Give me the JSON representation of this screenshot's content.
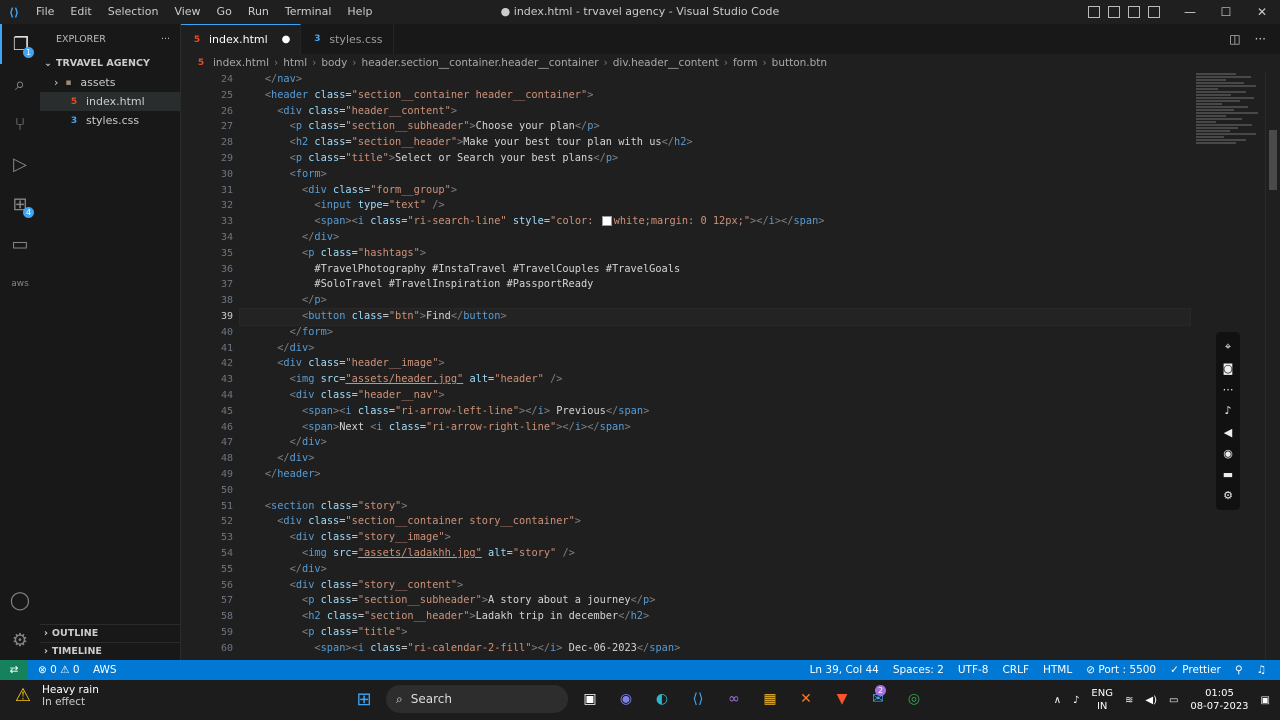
{
  "titlebar": {
    "menu": [
      "File",
      "Edit",
      "Selection",
      "View",
      "Go",
      "Run",
      "Terminal",
      "Help"
    ],
    "title": "● index.html - trvavel agency - Visual Studio Code"
  },
  "sidebar": {
    "header": "EXPLORER",
    "folder": "TRVAVEL AGENCY",
    "items": [
      {
        "label": "assets",
        "type": "folder"
      },
      {
        "label": "index.html",
        "type": "html"
      },
      {
        "label": "styles.css",
        "type": "css"
      }
    ],
    "outline": "OUTLINE",
    "timeline": "TIMELINE"
  },
  "activity": {
    "explorer_badge": "1",
    "extensions_badge": "4"
  },
  "tabs": [
    {
      "label": "index.html",
      "modified": "●",
      "active": true
    },
    {
      "label": "styles.css",
      "modified": "",
      "active": false
    }
  ],
  "breadcrumbs": [
    "index.html",
    "html",
    "body",
    "header.section__container.header__container",
    "div.header__content",
    "form",
    "button.btn"
  ],
  "editor": {
    "line_numbers": [
      "24",
      "25",
      "26",
      "27",
      "28",
      "29",
      "30",
      "31",
      "32",
      "33",
      "34",
      "35",
      "36",
      "37",
      "38",
      "39",
      "40",
      "41",
      "42",
      "43",
      "44",
      "45",
      "46",
      "47",
      "48",
      "49",
      "50",
      "51",
      "52",
      "53",
      "54",
      "55",
      "56",
      "57",
      "58",
      "59",
      "60"
    ],
    "current_line": "39",
    "lines": [
      "    </nav>",
      "    <header class=\"section__container header__container\">",
      "      <div class=\"header__content\">",
      "        <p class=\"section__subheader\">Choose your plan</p>",
      "        <h2 class=\"section__header\">Make your best tour plan with us</h2>",
      "        <p class=\"title\">Select or Search your best plans</p>",
      "        <form>",
      "          <div class=\"form__group\">",
      "            <input type=\"text\" />",
      "            <span><i class=\"ri-search-line\" style=\"color: ",
      "          </div>",
      "          <p class=\"hashtags\">",
      "            #TravelPhotography #InstaTravel #TravelCouples #TravelGoals",
      "            #SoloTravel #TravelInspiration #PassportReady",
      "          </p>",
      "          <button class=\"btn\">Find</button>",
      "        </form>",
      "      </div>",
      "      <div class=\"header__image\">",
      "        <img src=\"assets/header.jpg\" alt=\"header\" />",
      "        <div class=\"header__nav\">",
      "          <span><i class=\"ri-arrow-left-line\"></i> Previous</span>",
      "          <span>Next <i class=\"ri-arrow-right-line\"></i></span>",
      "        </div>",
      "      </div>",
      "    </header>",
      "",
      "    <section class=\"story\">",
      "      <div class=\"section__container story__container\">",
      "        <div class=\"story__image\">",
      "          <img src=\"assets/ladakhh.jpg\" alt=\"story\" />",
      "        </div>",
      "        <div class=\"story__content\">",
      "          <p class=\"section__subheader\">A story about a journey</p>",
      "          <h2 class=\"section__header\">Ladakh trip in december</h2>",
      "          <p class=\"title\">",
      "            <span><i class=\"ri-calendar-2-fill\"></i> Dec-06-2023</span>"
    ],
    "line33_tail": "white;margin: 0 12px;\"></i></span>"
  },
  "status": {
    "problems": "⊗ 0 ⚠ 0",
    "aws": "AWS",
    "position": "Ln 39, Col 44",
    "spaces": "Spaces: 2",
    "encoding": "UTF-8",
    "eol": "CRLF",
    "language": "HTML",
    "port": "Port : 5500",
    "prettier": "Prettier"
  },
  "taskbar": {
    "weather_title": "Heavy rain",
    "weather_sub": "In effect",
    "search": "Search",
    "lang1": "ENG",
    "lang2": "IN",
    "time": "01:05",
    "date": "08-07-2023",
    "mail_badge": "2"
  }
}
